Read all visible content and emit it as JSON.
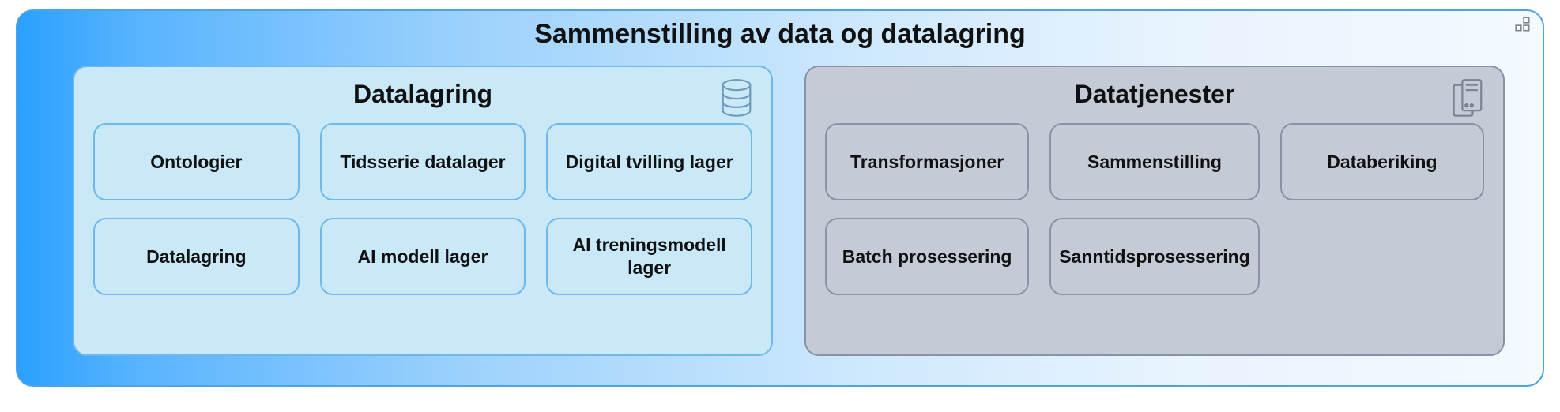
{
  "diagram": {
    "title": "Sammenstilling av data og datalagring",
    "panels": {
      "storage": {
        "title": "Datalagring",
        "icon": "database",
        "items": [
          "Ontologier",
          "Tidsserie datalager",
          "Digital tvilling lager",
          "Datalagring",
          "AI modell lager",
          "AI treningsmodell lager"
        ]
      },
      "services": {
        "title": "Datatjenester",
        "icon": "server",
        "items": [
          "Transformasjoner",
          "Sammenstilling",
          "Databeriking",
          "Batch prosessering",
          "Sanntidsprosessering"
        ]
      }
    }
  }
}
